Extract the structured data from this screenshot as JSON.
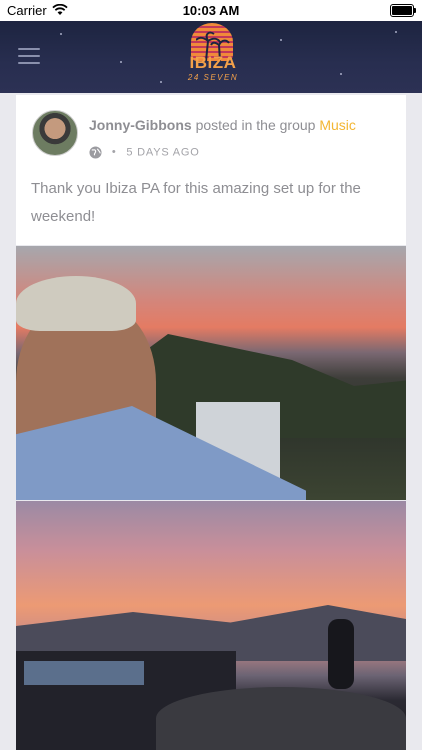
{
  "status_bar": {
    "carrier": "Carrier",
    "time": "10:03 AM"
  },
  "header": {
    "logo_text": "IBIZA",
    "logo_sub": "24 SEVEN",
    "menu_icon": "hamburger-menu-icon"
  },
  "post": {
    "author": "Jonny-Gibbons",
    "action": "posted in the group",
    "group": "Music",
    "time": "5 DAYS AGO",
    "visibility_icon": "globe-icon",
    "text": "Thank you Ibiza PA for this amazing set up for the weekend!"
  },
  "colors": {
    "header_bg": "#282e50",
    "group_link": "#f3b633",
    "meta_text": "#8e8e93",
    "logo_orange": "#f3a14a"
  }
}
